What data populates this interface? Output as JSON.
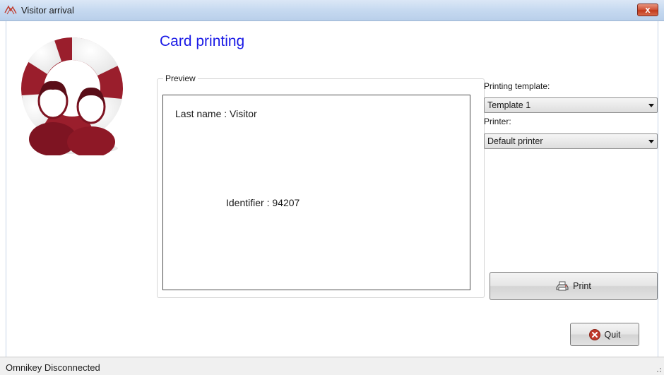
{
  "window": {
    "title": "Visitor arrival",
    "close_label": "x"
  },
  "page": {
    "title": "Card printing"
  },
  "preview": {
    "legend": "Preview",
    "last_name_line": "Last name : Visitor",
    "identifier_line": "Identifier : 94207"
  },
  "printing_template": {
    "label": "Printing template:",
    "value": "Template 1"
  },
  "printer": {
    "label": "Printer:",
    "value": "Default printer"
  },
  "buttons": {
    "print": "Print",
    "quit": "Quit"
  },
  "status": {
    "text": "Omnikey Disconnected"
  },
  "colors": {
    "title_blue": "#1a1ae6",
    "logo_red": "#9a1e2c",
    "close_red": "#c23a1c"
  },
  "icons": [
    "visitor-logo-icon",
    "window-app-icon",
    "close-icon",
    "printer-icon",
    "quit-icon",
    "resize-grip-icon"
  ]
}
